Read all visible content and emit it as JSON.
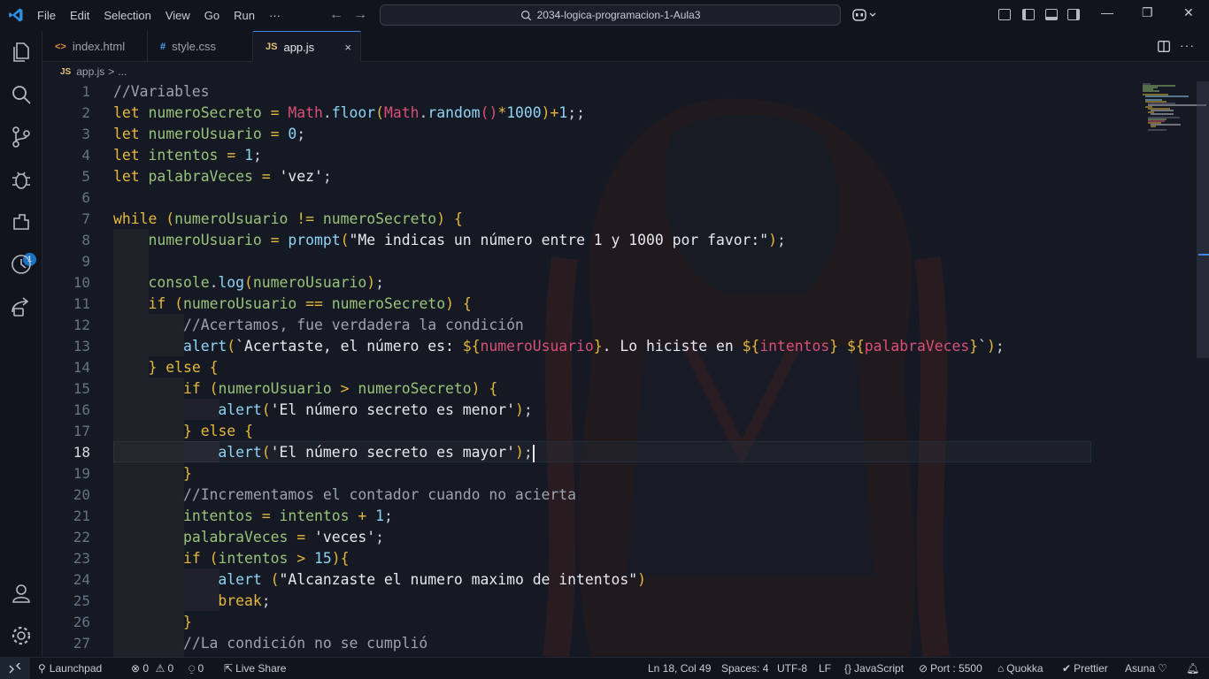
{
  "menubar": {
    "items": [
      "File",
      "Edit",
      "Selection",
      "View",
      "Go",
      "Run",
      "···"
    ],
    "search": "2034-logica-programacion-1-Aula3"
  },
  "tabs": [
    {
      "icon": "<>",
      "label": "index.html",
      "active": false
    },
    {
      "icon": "#",
      "label": "style.css",
      "active": false
    },
    {
      "icon": "JS",
      "label": "app.js",
      "active": true,
      "close": "×"
    }
  ],
  "breadcrumb": {
    "icon": "JS",
    "file": "app.js",
    "sep": ">",
    "rest": "..."
  },
  "activity": {
    "extensions_badge": "1"
  },
  "editor": {
    "current_line": 18,
    "line_numbers": [
      "1",
      "2",
      "3",
      "4",
      "5",
      "6",
      "7",
      "8",
      "9",
      "10",
      "11",
      "12",
      "13",
      "14",
      "15",
      "16",
      "17",
      "18",
      "19",
      "20",
      "21",
      "22",
      "23",
      "24",
      "25",
      "26",
      "27"
    ],
    "lines": [
      "//Variables",
      "let numeroSecreto = Math.floor(Math.random()*1000)+1;;",
      "let numeroUsuario = 0;",
      "let intentos = 1;",
      "let palabraVeces = 'vez';",
      "",
      "while (numeroUsuario != numeroSecreto) {",
      "    numeroUsuario = prompt(\"Me indicas un número entre 1 y 1000 por favor:\");",
      "",
      "    console.log(numeroUsuario);",
      "    if (numeroUsuario == numeroSecreto) {",
      "        //Acertamos, fue verdadera la condición",
      "        alert(`Acertaste, el número es: ${numeroUsuario}. Lo hiciste en ${intentos} ${palabraVeces}`);",
      "    } else {",
      "        if (numeroUsuario > numeroSecreto) {",
      "            alert('El número secreto es menor');",
      "        } else {",
      "            alert('El número secreto es mayor');",
      "        }",
      "        //Incrementamos el contador cuando no acierta",
      "        intentos = intentos + 1;",
      "        palabraVeces = 'veces';",
      "        if (intentos > 15){",
      "            alert (\"Alcanzaste el numero maximo de intentos\")",
      "            break;",
      "        }",
      "        //La condición no se cumplió"
    ]
  },
  "statusbar": {
    "launchpad": "Launchpad",
    "problems_errors": "0",
    "problems_warnings": "0",
    "ports_count": "0",
    "live_share": "Live Share",
    "cursor_pos": "Ln 18, Col 49",
    "spaces": "Spaces: 4",
    "encoding": "UTF-8",
    "eol": "LF",
    "language": "JavaScript",
    "port": "Port : 5500",
    "quokka": "Quokka",
    "prettier": "Prettier",
    "theme": "Asuna"
  },
  "colors": {
    "background": "#151923",
    "accent": "#3c8ae6",
    "keyword": "#e5b73b",
    "variable": "#98c379",
    "object": "#d84f78",
    "function": "#8fd3f5"
  }
}
